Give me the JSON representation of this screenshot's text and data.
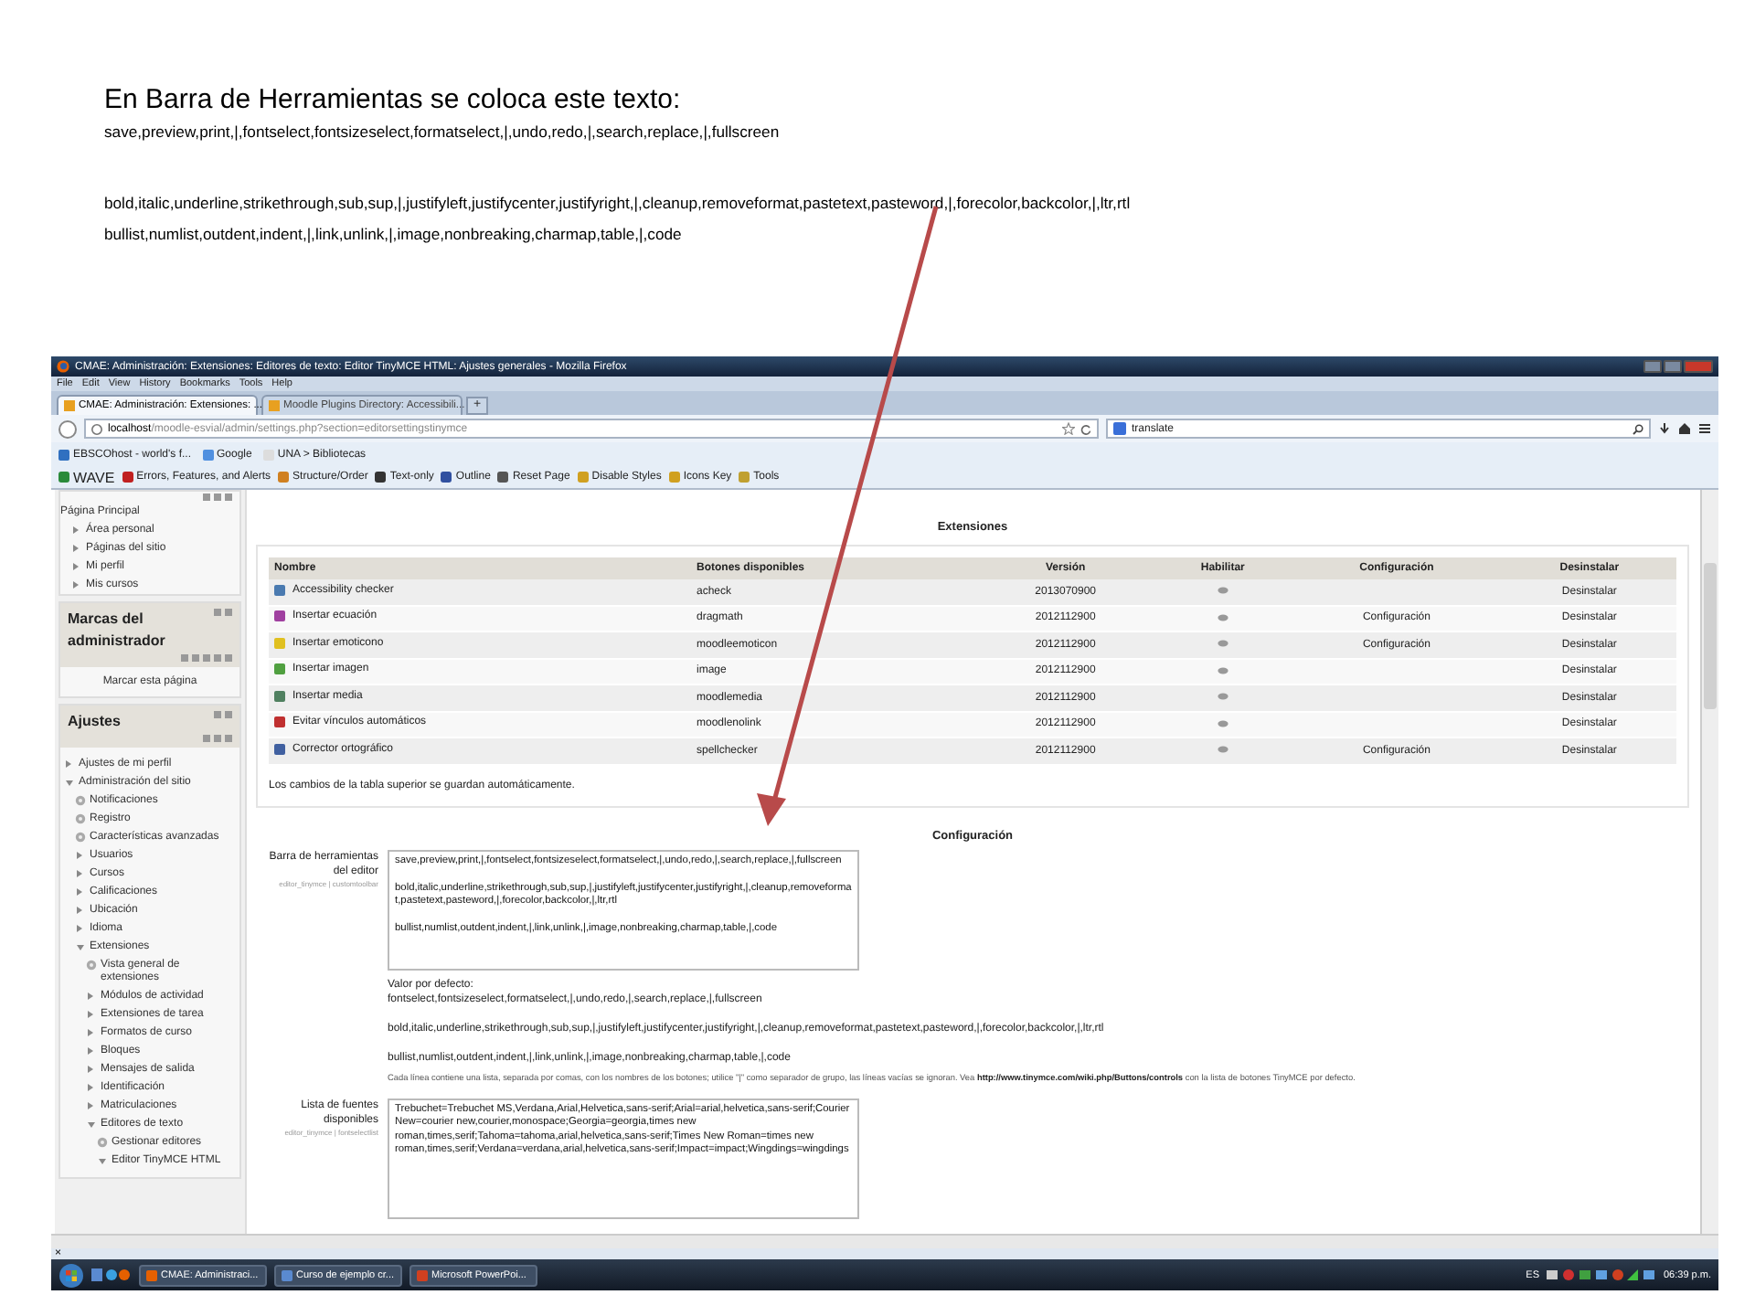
{
  "slide": {
    "heading": "En Barra de Herramientas se coloca este texto:",
    "lines": [
      "save,preview,print,|,fontselect,fontsizeselect,formatselect,|,undo,redo,|,search,replace,|,fullscreen",
      "bold,italic,underline,strikethrough,sub,sup,|,justifyleft,justifycenter,justifyright,|,cleanup,removeformat,pastetext,pasteword,|,forecolor,backcolor,|,ltr,rtl",
      "bullist,numlist,outdent,indent,|,link,unlink,|,image,nonbreaking,charmap,table,|,code"
    ]
  },
  "browser": {
    "window_title": "CMAE: Administración: Extensiones: Editores de texto: Editor TinyMCE HTML: Ajustes generales - Mozilla Firefox",
    "menu": [
      "File",
      "Edit",
      "View",
      "History",
      "Bookmarks",
      "Tools",
      "Help"
    ],
    "tabs": [
      {
        "label": "CMAE: Administración: Extensiones: ...",
        "selected": true
      },
      {
        "label": "Moodle Plugins Directory: Accessibili...",
        "selected": false
      }
    ],
    "new_tab": "+",
    "address": {
      "host": "localhost",
      "path": "/moodle-esvial/admin/settings.php?section=editorsettingstinymce"
    },
    "search": {
      "value": "translate"
    },
    "bookmarks": [
      "EBSCOhost - world's f...",
      "Google",
      "UNA > Bibliotecas"
    ],
    "wave_toolbar": [
      "WAVE",
      "Errors, Features, and Alerts",
      "Structure/Order",
      "Text-only",
      "Outline",
      "Reset Page",
      "Disable Styles",
      "Icons Key",
      "Tools"
    ]
  },
  "sidebar": {
    "navigation": [
      {
        "label": "Página Principal",
        "children": [
          {
            "label": "Área personal",
            "kind": "branch",
            "expanded": false
          },
          {
            "label": "Páginas del sitio",
            "kind": "branch",
            "expanded": false
          },
          {
            "label": "Mi perfil",
            "kind": "branch",
            "expanded": false
          },
          {
            "label": "Mis cursos",
            "kind": "branch",
            "expanded": false
          }
        ]
      }
    ],
    "admin_bookmarks": {
      "title": "Marcas del administrador",
      "link": "Marcar esta página"
    },
    "settings": {
      "title": "Ajustes",
      "tree": [
        {
          "label": "Ajustes de mi perfil",
          "kind": "branch",
          "expanded": false
        },
        {
          "label": "Administración del sitio",
          "kind": "branch",
          "expanded": true,
          "children": [
            {
              "label": "Notificaciones",
              "kind": "gear"
            },
            {
              "label": "Registro",
              "kind": "gear"
            },
            {
              "label": "Características avanzadas",
              "kind": "gear"
            },
            {
              "label": "Usuarios",
              "kind": "branch",
              "expanded": false
            },
            {
              "label": "Cursos",
              "kind": "branch",
              "expanded": false
            },
            {
              "label": "Calificaciones",
              "kind": "branch",
              "expanded": false
            },
            {
              "label": "Ubicación",
              "kind": "branch",
              "expanded": false
            },
            {
              "label": "Idioma",
              "kind": "branch",
              "expanded": false
            },
            {
              "label": "Extensiones",
              "kind": "branch",
              "expanded": true,
              "children": [
                {
                  "label": "Vista general de extensiones",
                  "kind": "gear"
                },
                {
                  "label": "Módulos de actividad",
                  "kind": "branch",
                  "expanded": false
                },
                {
                  "label": "Extensiones de tarea",
                  "kind": "branch",
                  "expanded": false
                },
                {
                  "label": "Formatos de curso",
                  "kind": "branch",
                  "expanded": false
                },
                {
                  "label": "Bloques",
                  "kind": "branch",
                  "expanded": false
                },
                {
                  "label": "Mensajes de salida",
                  "kind": "branch",
                  "expanded": false
                },
                {
                  "label": "Identificación",
                  "kind": "branch",
                  "expanded": false
                },
                {
                  "label": "Matriculaciones",
                  "kind": "branch",
                  "expanded": false
                },
                {
                  "label": "Editores de texto",
                  "kind": "branch",
                  "expanded": true,
                  "children": [
                    {
                      "label": "Gestionar editores",
                      "kind": "gear"
                    },
                    {
                      "label": "Editor TinyMCE HTML",
                      "kind": "branch",
                      "expanded": true
                    }
                  ]
                }
              ]
            }
          ]
        }
      ]
    }
  },
  "plugins": {
    "heading": "Extensiones",
    "columns": [
      "Nombre",
      "Botones disponibles",
      "Versión",
      "Habilitar",
      "Configuración",
      "Desinstalar"
    ],
    "rows": [
      {
        "name": "Accessibility checker",
        "color": "#4a7ab0",
        "buttons": "acheck",
        "version": "2013070900",
        "uninstall": "Desinstalar"
      },
      {
        "name": "Insertar ecuación",
        "color": "#a040a0",
        "buttons": "dragmath",
        "version": "2012112900",
        "config": "Configuración",
        "uninstall": "Desinstalar"
      },
      {
        "name": "Insertar emoticono",
        "color": "#e0c020",
        "buttons": "moodleemoticon",
        "version": "2012112900",
        "config": "Configuración",
        "uninstall": "Desinstalar"
      },
      {
        "name": "Insertar imagen",
        "color": "#50a040",
        "buttons": "image",
        "version": "2012112900",
        "uninstall": "Desinstalar"
      },
      {
        "name": "Insertar media",
        "color": "#508060",
        "buttons": "moodlemedia",
        "version": "2012112900",
        "uninstall": "Desinstalar"
      },
      {
        "name": "Evitar vínculos automáticos",
        "color": "#c03030",
        "buttons": "moodlenolink",
        "version": "2012112900",
        "uninstall": "Desinstalar"
      },
      {
        "name": "Corrector ortográfico",
        "color": "#4060a0",
        "buttons": "spellchecker",
        "version": "2012112900",
        "config": "Configuración",
        "uninstall": "Desinstalar"
      }
    ],
    "note": "Los cambios de la tabla superior se guardan automáticamente."
  },
  "configuration": {
    "heading": "Configuración",
    "settings": [
      {
        "label": "Barra de herramientas del editor",
        "key": "editor_tinymce | customtoolbar",
        "value": "save,preview,print,|,fontselect,fontsizeselect,formatselect,|,undo,redo,|,search,replace,|,fullscreen\n\nbold,italic,underline,strikethrough,sub,sup,|,justifyleft,justifycenter,justifyright,|,cleanup,removeformat,pastetext,pasteword,|,forecolor,backcolor,|,ltr,rtl\n\nbullist,numlist,outdent,indent,|,link,unlink,|,image,nonbreaking,charmap,table,|,code",
        "default_label": "Valor por defecto:",
        "default_lines": [
          "fontselect,fontsizeselect,formatselect,|,undo,redo,|,search,replace,|,fullscreen",
          "bold,italic,underline,strikethrough,sub,sup,|,justifyleft,justifycenter,justifyright,|,cleanup,removeformat,pastetext,pasteword,|,forecolor,backcolor,|,ltr,rtl",
          "bullist,numlist,outdent,indent,|,link,unlink,|,image,nonbreaking,charmap,table,|,code"
        ],
        "description_before": "Cada línea contiene una lista, separada por comas, con los nombres de los botones; utilice \"|\" como separador de grupo, las líneas vacías se ignoran. Vea",
        "description_link": "http://www.tinymce.com/wiki.php/Buttons/controls",
        "description_after": "con la lista de botones TinyMCE por defecto."
      },
      {
        "label": "Lista de fuentes disponibles",
        "key": "editor_tinymce | fontselectlist",
        "value": "Trebuchet=Trebuchet MS,Verdana,Arial,Helvetica,sans-serif;Arial=arial,helvetica,sans-serif;Courier New=courier new,courier,monospace;Georgia=georgia,times new roman,times,serif;Tahoma=tahoma,arial,helvetica,sans-serif;Times New Roman=times new roman,times,serif;Verdana=verdana,arial,helvetica,sans-serif;Impact=impact;Wingdings=wingdings"
      }
    ]
  },
  "findbar_close": "×",
  "taskbar": {
    "tasks": [
      "CMAE: Administraci...",
      "Curso de ejemplo cr...",
      "Microsoft PowerPoi..."
    ],
    "language": "ES",
    "clock": "06:39 p.m."
  }
}
